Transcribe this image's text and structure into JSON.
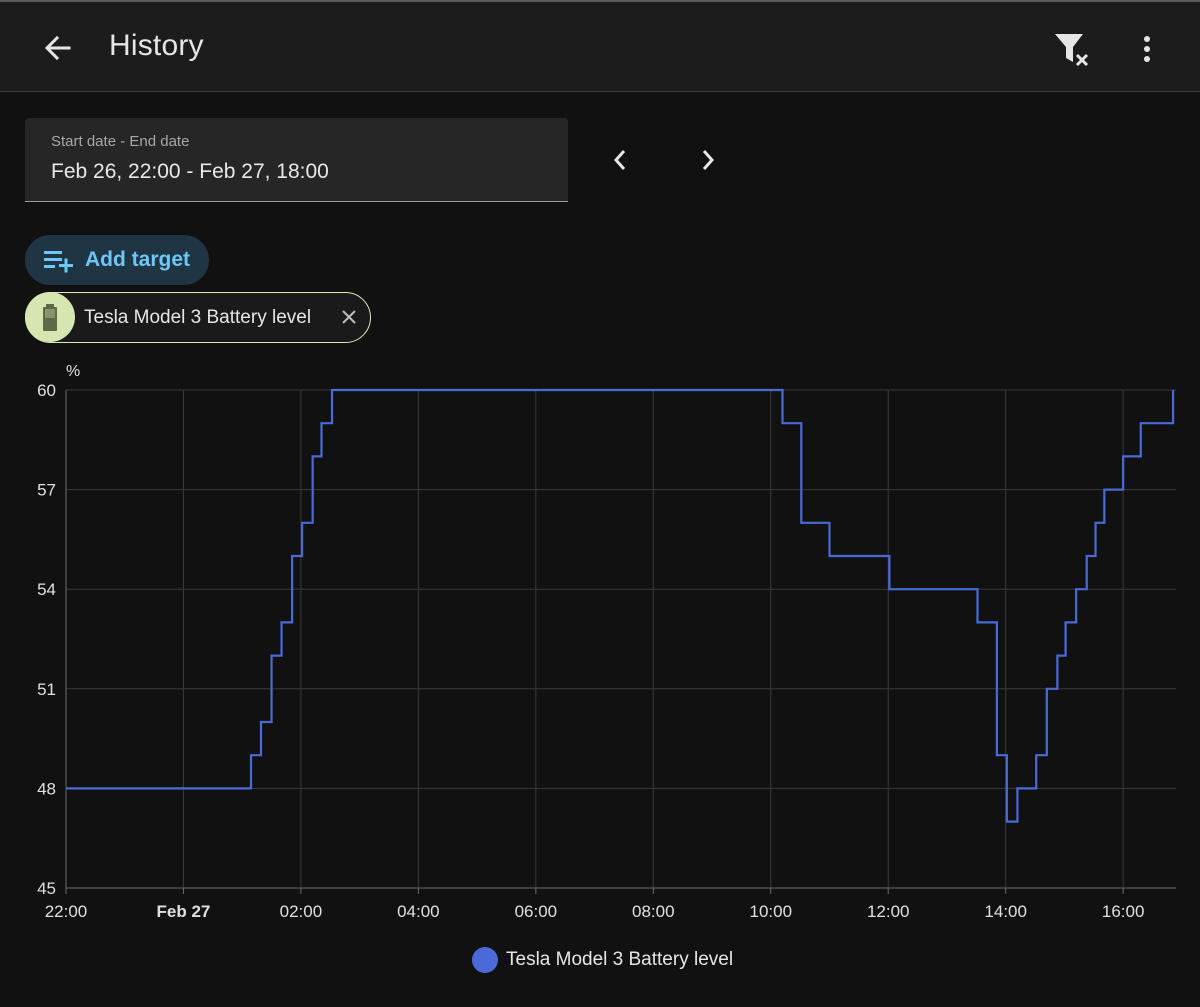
{
  "header": {
    "title": "History",
    "back_icon": "arrow-left-icon",
    "filter_icon": "filter-remove-icon",
    "more_icon": "dots-vertical-icon"
  },
  "date_range": {
    "label": "Start date - End date",
    "value": "Feb 26, 22:00 - Feb 27, 18:00"
  },
  "add_target": {
    "label": "Add target",
    "icon": "playlist-plus-icon"
  },
  "chip": {
    "label": "Tesla Model 3 Battery level",
    "icon": "battery-icon",
    "remove_icon": "close-icon"
  },
  "colors": {
    "accent": "#6ec6f5",
    "series": "#4a6ad8",
    "chip_bg": "#d7e6b1"
  },
  "chart_data": {
    "type": "line",
    "step": true,
    "ylabel": "%",
    "ylim": [
      45,
      60
    ],
    "yticks": [
      45,
      48,
      51,
      54,
      57,
      60
    ],
    "x_unit": "hours",
    "xlim": [
      22,
      40.9
    ],
    "xticks": [
      {
        "x": 22,
        "label": "22:00",
        "bold": false
      },
      {
        "x": 24,
        "label": "Feb 27",
        "bold": true
      },
      {
        "x": 26,
        "label": "02:00",
        "bold": false
      },
      {
        "x": 28,
        "label": "04:00",
        "bold": false
      },
      {
        "x": 30,
        "label": "06:00",
        "bold": false
      },
      {
        "x": 32,
        "label": "08:00",
        "bold": false
      },
      {
        "x": 34,
        "label": "10:00",
        "bold": false
      },
      {
        "x": 36,
        "label": "12:00",
        "bold": false
      },
      {
        "x": 38,
        "label": "14:00",
        "bold": false
      },
      {
        "x": 40,
        "label": "16:00",
        "bold": false
      }
    ],
    "grid": true,
    "legend": "bottom",
    "series": [
      {
        "name": "Tesla Model 3 Battery level",
        "points": [
          [
            22.0,
            48
          ],
          [
            25.15,
            49
          ],
          [
            25.32,
            50
          ],
          [
            25.5,
            52
          ],
          [
            25.67,
            53
          ],
          [
            25.85,
            55
          ],
          [
            26.02,
            56
          ],
          [
            26.2,
            58
          ],
          [
            26.35,
            59
          ],
          [
            26.53,
            60
          ],
          [
            34.2,
            59
          ],
          [
            34.52,
            56
          ],
          [
            35.0,
            55
          ],
          [
            36.02,
            54
          ],
          [
            37.52,
            53
          ],
          [
            37.85,
            49
          ],
          [
            38.02,
            47
          ],
          [
            38.2,
            48
          ],
          [
            38.52,
            49
          ],
          [
            38.7,
            51
          ],
          [
            38.88,
            52
          ],
          [
            39.02,
            53
          ],
          [
            39.2,
            54
          ],
          [
            39.38,
            55
          ],
          [
            39.53,
            56
          ],
          [
            39.68,
            57
          ],
          [
            40.0,
            58
          ],
          [
            40.3,
            59
          ],
          [
            40.85,
            60
          ]
        ]
      }
    ]
  }
}
